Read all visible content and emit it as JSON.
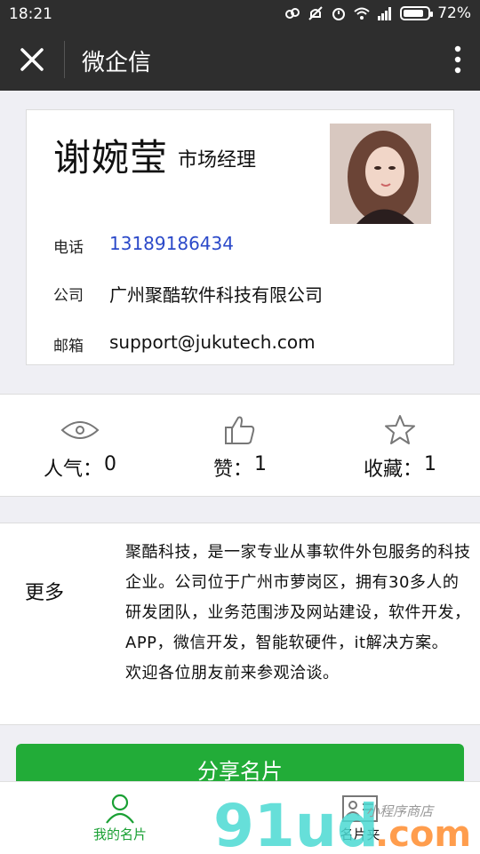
{
  "status_bar": {
    "time": "18:21",
    "battery": "72%"
  },
  "nav": {
    "title": "微企信"
  },
  "card": {
    "name": "谢婉莹",
    "role": "市场经理",
    "rows": [
      {
        "label": "电话",
        "value": "13189186434"
      },
      {
        "label": "公司",
        "value": "广州聚酷软件科技有限公司"
      },
      {
        "label": "邮箱",
        "value": "support@jukutech.com"
      }
    ]
  },
  "stats": [
    {
      "icon": "eye-icon",
      "label": "人气：",
      "value": "0"
    },
    {
      "icon": "thumbs-up-icon",
      "label": "赞：",
      "value": "1"
    },
    {
      "icon": "star-icon",
      "label": "收藏：",
      "value": "1"
    }
  ],
  "more": {
    "label": "更多",
    "description": "聚酷科技，是一家专业从事软件外包服务的科技企业。公司位于广州市萝岗区，拥有30多人的研发团队，业务范围涉及网站建设，软件开发，APP，微信开发，智能软硬件，it解决方案。",
    "welcome": "欢迎各位朋友前来参观洽谈。"
  },
  "share_button": "分享名片",
  "tabs": [
    {
      "label": "我的名片",
      "active": true
    },
    {
      "label": "名片夹",
      "active": false
    }
  ],
  "watermark": {
    "logo": "91ud.com",
    "tagline": "小程序商店"
  },
  "colors": {
    "accent": "#22ac38",
    "phone": "#2b49c9",
    "nav_bg": "#2e2e2e"
  }
}
